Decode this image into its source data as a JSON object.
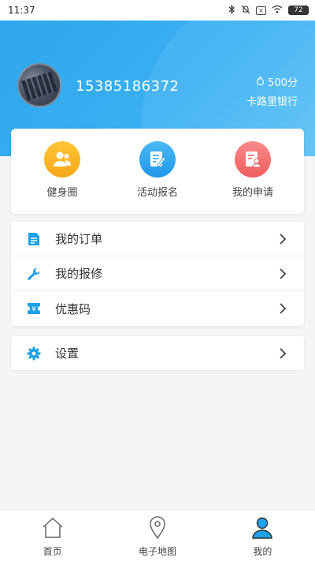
{
  "status_bar": {
    "time": "11:37",
    "battery": "72",
    "icons": [
      "bluetooth-icon",
      "mute-icon",
      "signal-x-icon",
      "wifi-icon",
      "battery-icon"
    ]
  },
  "profile": {
    "phone": "15385186372",
    "points": "500分",
    "calorie_bank": "卡路里银行"
  },
  "shortcuts": [
    {
      "label": "健身圈",
      "icon": "fitness-circle-icon",
      "color": "#f9b52a"
    },
    {
      "label": "活动报名",
      "icon": "activity-signup-icon",
      "color": "#2aa3ef"
    },
    {
      "label": "我的申请",
      "icon": "my-application-icon",
      "color": "#f06a6b"
    }
  ],
  "menu": [
    {
      "label": "我的订单",
      "icon": "order-icon"
    },
    {
      "label": "我的报修",
      "icon": "wrench-icon"
    },
    {
      "label": "优惠码",
      "icon": "coupon-icon"
    }
  ],
  "settings": {
    "label": "设置",
    "icon": "gear-icon"
  },
  "tabbar": [
    {
      "label": "首页",
      "icon": "home-icon"
    },
    {
      "label": "电子地图",
      "icon": "map-pin-icon"
    },
    {
      "label": "我的",
      "icon": "user-icon"
    }
  ],
  "colors": {
    "header_blue": "#2ea6ee",
    "accent_blue": "#1fa0ea"
  }
}
